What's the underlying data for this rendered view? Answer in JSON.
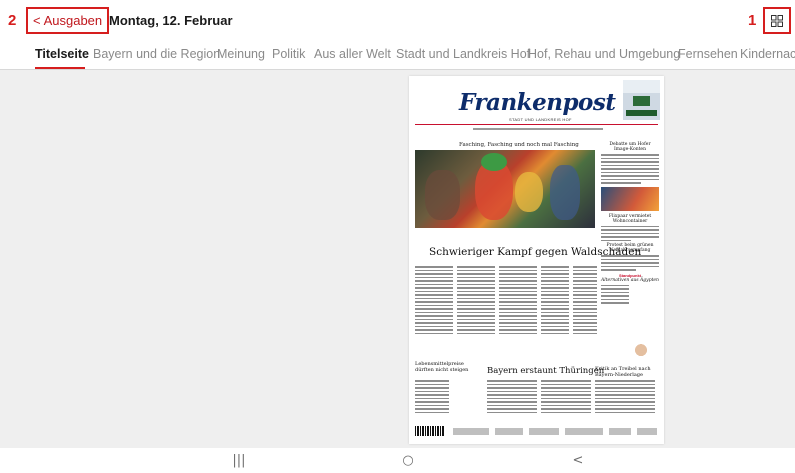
{
  "markers": {
    "back": "2",
    "grid": "1"
  },
  "header": {
    "back_label": "Ausgaben",
    "back_icon": "chevron-left-icon",
    "date": "Montag, 12. Februar",
    "grid_icon": "grid-view-icon"
  },
  "tabs": [
    {
      "label": "Titelseite",
      "active": true
    },
    {
      "label": "Bayern und die Region",
      "active": false
    },
    {
      "label": "Meinung",
      "active": false
    },
    {
      "label": "Politik",
      "active": false
    },
    {
      "label": "Aus aller Welt",
      "active": false
    },
    {
      "label": "Stadt und Landkreis Hof",
      "active": false
    },
    {
      "label": "Hof, Rehau und Umgebung",
      "active": false
    },
    {
      "label": "Fernsehen",
      "active": false
    },
    {
      "label": "Kindernachrichten",
      "active": false
    }
  ],
  "newspaper": {
    "masthead": "Frankenpost",
    "subtitle": "STADT UND LANDKREIS HOF",
    "headline_photo": "Fasching, Fasching und noch mal Fasching",
    "headline_main": "Schwieriger Kampf gegen Waldschäden",
    "headline_bottom_center": "Bayern erstaunt Thüringen",
    "headline_bottom_left": "Lebensmittelpreise dürften nicht steigen",
    "headline_bottom_right": "Kritik an Treibel nach Bayern-Niederlage",
    "side_headlines": [
      "Debatte um Hofer Image-Konten",
      "Flixpaar vermietet Wohncontainer",
      "Protest beim grünen Neujahrsempfang",
      "Standpunkt",
      "Alternativen aus Ägypten"
    ]
  },
  "nav": {
    "recents_icon": "recents-icon",
    "home_icon": "home-icon",
    "back_icon": "back-icon",
    "recents_glyph": "|||",
    "home_glyph": "○",
    "back_glyph": "<"
  },
  "colors": {
    "accent": "#d61e1e",
    "masthead": "#0d2c6b"
  }
}
